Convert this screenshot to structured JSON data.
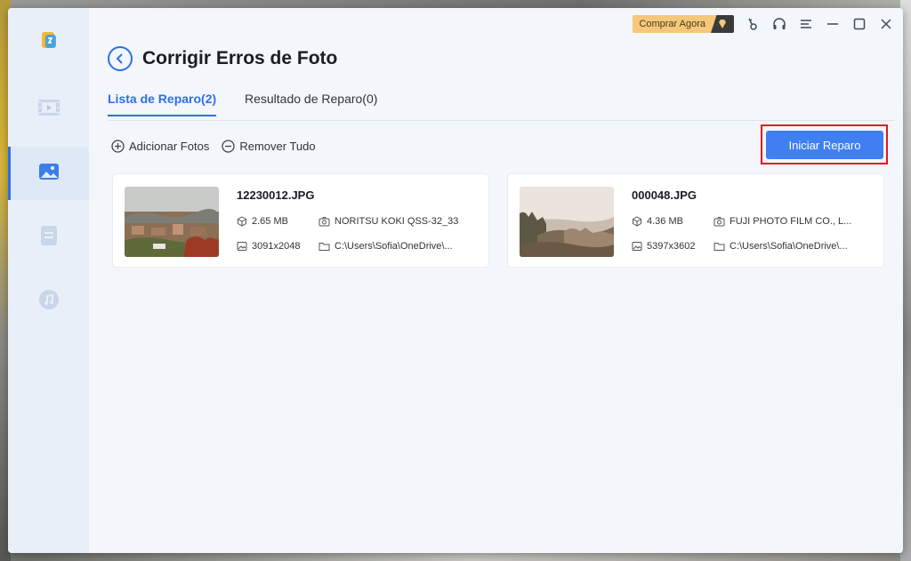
{
  "app": {
    "buy_label": "Comprar Agora",
    "accent_color": "#2f6fe4",
    "sidebar_items": [
      {
        "icon": "app-logo-icon"
      },
      {
        "icon": "video-icon"
      },
      {
        "icon": "photo-icon",
        "active": true
      },
      {
        "icon": "document-icon"
      },
      {
        "icon": "music-icon"
      }
    ]
  },
  "header": {
    "title": "Corrigir Erros de Foto"
  },
  "tabs": [
    {
      "label": "Lista de Reparo(2)",
      "active": true
    },
    {
      "label": "Resultado de Reparo(0)",
      "active": false
    }
  ],
  "actions": {
    "add_label": "Adicionar Fotos",
    "remove_label": "Remover Tudo",
    "start_label": "Iniciar Reparo"
  },
  "files": [
    {
      "name": "12230012.JPG",
      "size": "2.65 MB",
      "camera": "NORITSU KOKI QSS-32_33",
      "resolution": "3091x2048",
      "path": "C:\\Users\\Sofia\\OneDrive\\..."
    },
    {
      "name": "000048.JPG",
      "size": "4.36 MB",
      "camera": "FUJI PHOTO FILM CO., L...",
      "resolution": "5397x3602",
      "path": "C:\\Users\\Sofia\\OneDrive\\..."
    }
  ]
}
